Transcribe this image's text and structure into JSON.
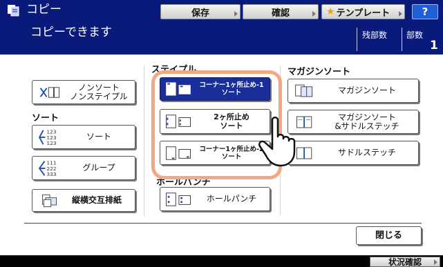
{
  "header": {
    "app_title": "コピー",
    "status": "コピーできます",
    "save_label": "保存",
    "confirm_label": "確認",
    "template_label": "テンプレート",
    "help_label": "?",
    "remaining_label": "残部数",
    "copies_label": "部数",
    "copies_value": "1"
  },
  "sections": {
    "staple_label": "ステイプル",
    "sort_label": "ソート",
    "hole_punch_label": "ホールパンチ",
    "magazine_label": "マガジンソート"
  },
  "buttons": {
    "non_sort_line1": "ノンソート",
    "non_sort_line2": "ノンステイプル",
    "sort": "ソート",
    "group": "グループ",
    "rotate_sort": "縦横交互排紙",
    "corner_left_line1": "コーナー1ヶ所止め-1",
    "corner_left_line2": "ソート",
    "two_staple_line1": "2ヶ所止め",
    "two_staple_line2": "ソート",
    "corner_right_line1": "コーナー1ヶ所止め-2",
    "corner_right_line2": "ソート",
    "hole_punch": "ホールパンチ",
    "magazine_sort": "マガジンソート",
    "magazine_saddle_line1": "マガジンソート",
    "magazine_saddle_line2": "&サドルステッチ",
    "saddle_stitch": "サドルステッチ",
    "close": "閉じる"
  },
  "icon_text": {
    "sort_digits": [
      "123",
      "123",
      "123"
    ],
    "group_digits": [
      "111",
      "222",
      "333"
    ]
  },
  "footer": {
    "status_confirm": "状況確認"
  },
  "colors": {
    "header_bg": "#0a1a7a",
    "selected_button": "#1a2e9a",
    "highlight_ring": "#f2a882"
  }
}
